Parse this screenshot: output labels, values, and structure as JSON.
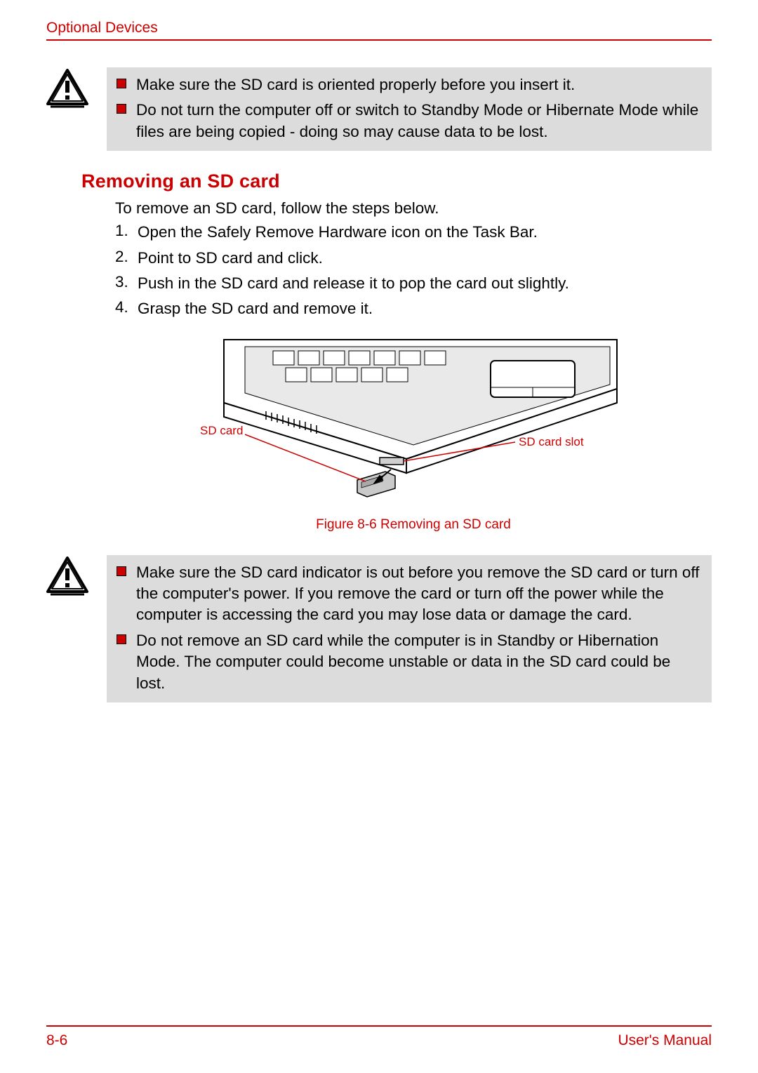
{
  "header": {
    "title": "Optional Devices"
  },
  "warning1": {
    "items": [
      "Make sure the SD card is oriented properly before you insert it.",
      "Do not turn the computer off or switch to Standby Mode or Hibernate Mode while files are being copied - doing so may cause data to be lost."
    ]
  },
  "section": {
    "heading": "Removing an SD card",
    "intro": "To remove an SD card, follow the steps below.",
    "steps": [
      "Open the Safely Remove Hardware  icon on the Task Bar.",
      "Point to SD card and click.",
      "Push in the SD card and release it to pop the card out slightly.",
      "Grasp the SD card and remove it."
    ]
  },
  "figure": {
    "label_left": "SD card",
    "label_right": "SD card slot",
    "caption": "Figure 8-6 Removing an SD card"
  },
  "warning2": {
    "items": [
      "Make sure the SD card indicator is out before you remove the SD card or turn off the computer's power. If you remove the card or turn off the power while the computer is accessing the card you may lose data or damage the card.",
      "Do not remove an SD card while the computer is in Standby or Hibernation Mode. The computer could become unstable or data in the SD card could be lost."
    ]
  },
  "footer": {
    "page": "8-6",
    "doc": "User's Manual"
  }
}
